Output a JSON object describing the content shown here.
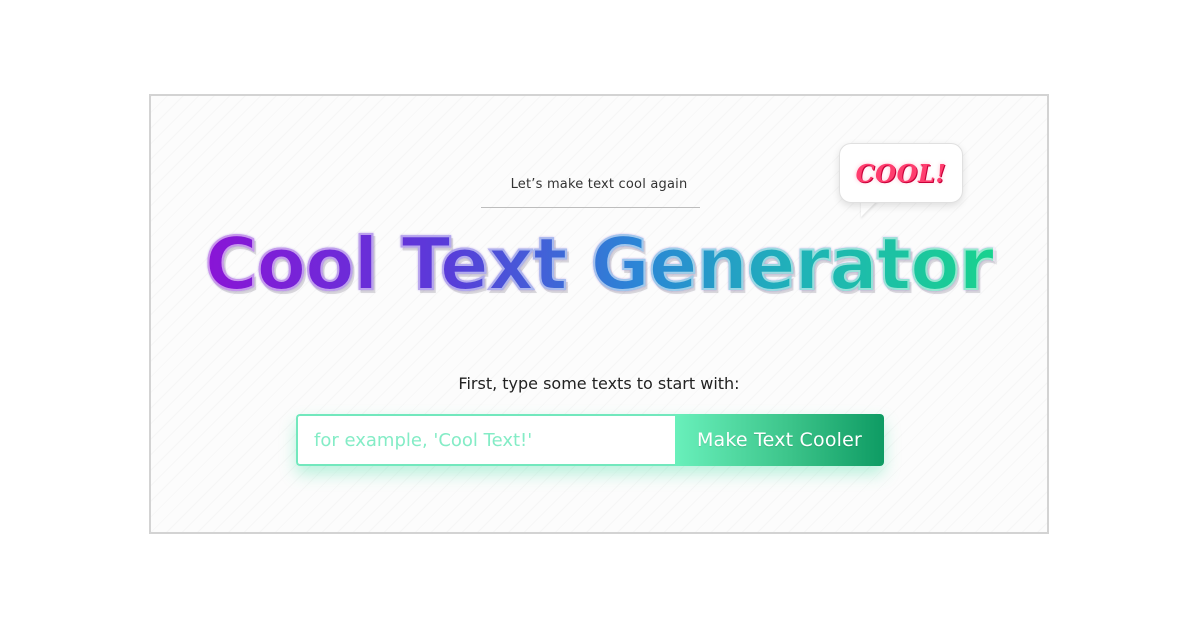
{
  "tagline": "Let’s make text cool again",
  "hero": {
    "title": "Cool Text Generator"
  },
  "badge": {
    "text": "COOL!"
  },
  "form": {
    "prompt": "First, type some texts to start with:",
    "input_placeholder": "for example, 'Cool Text!'",
    "input_value": "",
    "button_label": "Make Text Cooler"
  },
  "colors": {
    "title_gradient": [
      "#8a14d6",
      "#5a3ad9",
      "#2b86d6",
      "#1fb2b8",
      "#19d28e"
    ],
    "badge_text": "#ff3d6e",
    "button_gradient": [
      "#69f0bb",
      "#3cc48a",
      "#0e9b63"
    ],
    "input_border": "#72e8bd"
  }
}
